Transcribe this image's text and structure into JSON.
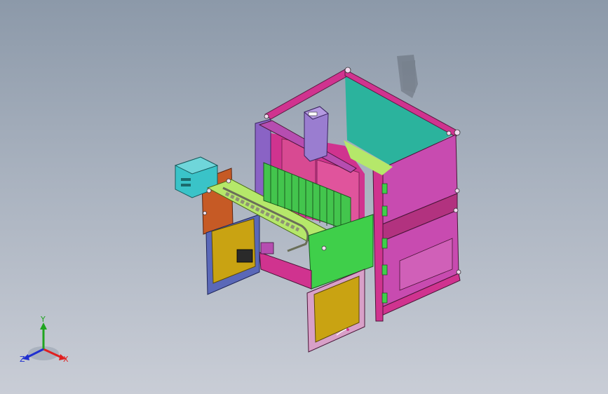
{
  "viewport": {
    "background_top": "#8c99a9",
    "background_bottom": "#c9cdd6"
  },
  "triad": {
    "x_label": "X",
    "y_label": "Y",
    "z_label": "Z",
    "x_color": "#e02020",
    "y_color": "#1fa51f",
    "z_color": "#2030d0"
  },
  "model": {
    "frame_color": "#d0338f",
    "panel_magenta": "#c84bb0",
    "panel_teal": "#2bb39d",
    "panel_green": "#3fcf4a",
    "panel_lightgreen": "#b5e86a",
    "panel_yellow": "#c9a312",
    "panel_cyan": "#3ac3c8",
    "panel_pink": "#d8a0c8",
    "panel_navy": "#5a68b8",
    "panel_orange": "#c65a25",
    "panel_violet": "#8a63c5"
  }
}
